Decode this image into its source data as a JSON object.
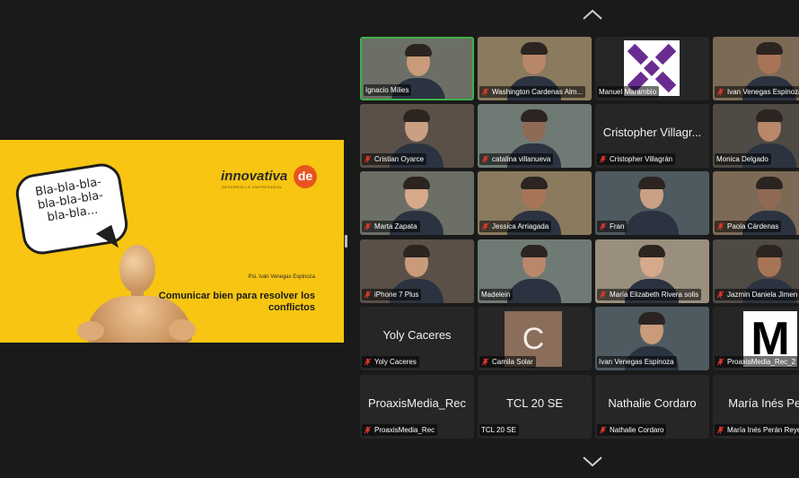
{
  "slide": {
    "bubble_lines": [
      "Bla-bla-bla-",
      "bla-bla-bla-",
      "bla-bla..."
    ],
    "brand_name": "innovativa",
    "brand_suffix": "de",
    "brand_tagline": "DESARROLLO EMPRESARIAL",
    "presenter": "Psi. Iván Venegas Espinoza",
    "title": "Comunicar bien para resolver los conflictos"
  },
  "gallery": {
    "participants": [
      {
        "name": "Ignacio Milies",
        "muted": false,
        "active": true,
        "video": "person"
      },
      {
        "name": "Washington Cardenas Alm...",
        "muted": true,
        "video": "person"
      },
      {
        "name": "Manuel Marambio",
        "muted": false,
        "video": "logo-x"
      },
      {
        "name": "Ivan Venegas Espinoza",
        "muted": true,
        "video": "person"
      },
      {
        "name": "Cristian Oyarce",
        "muted": true,
        "video": "person"
      },
      {
        "name": "catalina villanueva",
        "muted": true,
        "video": "person"
      },
      {
        "name": "Cristopher Villagrán",
        "muted": true,
        "video": "none",
        "display": "Cristopher Villagr..."
      },
      {
        "name": "Monica Delgado",
        "muted": false,
        "video": "person"
      },
      {
        "name": "Marta Zapata",
        "muted": true,
        "video": "person"
      },
      {
        "name": "Jessica Arriagada",
        "muted": true,
        "video": "person"
      },
      {
        "name": "Fran",
        "muted": true,
        "video": "person"
      },
      {
        "name": "Paola Cárdenas",
        "muted": true,
        "video": "person"
      },
      {
        "name": "iPhone 7 Plus",
        "muted": true,
        "video": "person"
      },
      {
        "name": "Madelein",
        "muted": false,
        "video": "person"
      },
      {
        "name": "María Elizabeth Rivera solis",
        "muted": true,
        "video": "person"
      },
      {
        "name": "Jazmin Daniela Jimen",
        "muted": true,
        "video": "person"
      },
      {
        "name": "Yoly Caceres",
        "muted": true,
        "video": "none",
        "display": "Yoly Caceres"
      },
      {
        "name": "Camila Solar",
        "muted": true,
        "video": "avatar-c",
        "avatar": "C"
      },
      {
        "name": "Ivan Venegas Espinoza",
        "muted": false,
        "video": "person"
      },
      {
        "name": "ProaxisMedia_Rec_2",
        "muted": true,
        "video": "avatar-m",
        "avatar": "M"
      },
      {
        "name": "ProaxisMedia_Rec",
        "muted": true,
        "video": "none",
        "display": "ProaxisMedia_Rec"
      },
      {
        "name": "TCL 20 SE",
        "muted": false,
        "video": "none",
        "display": "TCL 20 SE"
      },
      {
        "name": "Nathalie Cordaro",
        "muted": true,
        "video": "none",
        "display": "Nathalie Cordaro"
      },
      {
        "name": "María Inés Perán Reye",
        "muted": true,
        "video": "none",
        "display": "María Inés Pera"
      }
    ]
  },
  "colors": {
    "muted_red": "#e0372c",
    "active_border": "#3db24a",
    "slide_yellow": "#f7c512"
  }
}
